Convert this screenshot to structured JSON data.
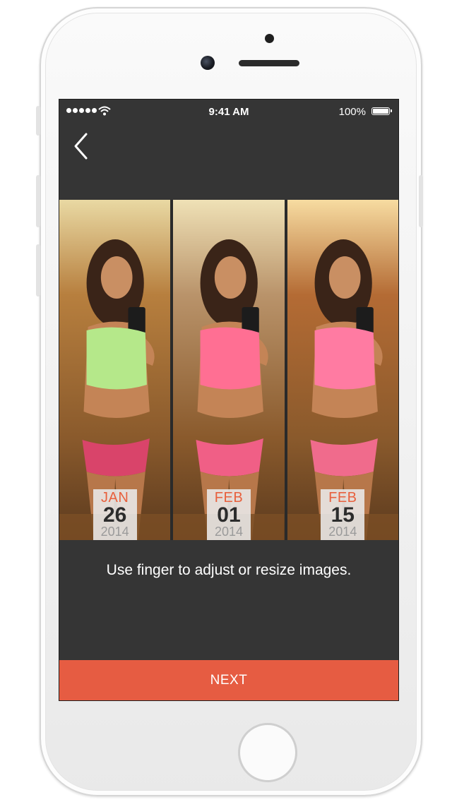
{
  "status_bar": {
    "time": "9:41 AM",
    "battery_percent": "100%",
    "signal_icon": "signal-dots-icon",
    "wifi_icon": "wifi-icon",
    "battery_icon": "battery-icon"
  },
  "nav": {
    "back_icon": "chevron-left-icon"
  },
  "photos": [
    {
      "month": "JAN",
      "day": "26",
      "year": "2014",
      "top_color": "#e9d9a3",
      "swatch": "#b77f3e",
      "top_garment": "#b5e88a",
      "bottom_garment": "#d9446a"
    },
    {
      "month": "FEB",
      "day": "01",
      "year": "2014",
      "top_color": "#efe1b6",
      "swatch": "#b9936a",
      "top_garment": "#ff6f93",
      "bottom_garment": "#f05f86"
    },
    {
      "month": "FEB",
      "day": "15",
      "year": "2014",
      "top_color": "#f7dca1",
      "swatch": "#b46b34",
      "top_garment": "#ff7ba2",
      "bottom_garment": "#f06b8c"
    }
  ],
  "instruction": "Use finger to adjust or resize images.",
  "next_button_label": "NEXT",
  "colors": {
    "accent": "#e65c42",
    "screen_bg": "#353535",
    "date_month": "#e8603d"
  }
}
